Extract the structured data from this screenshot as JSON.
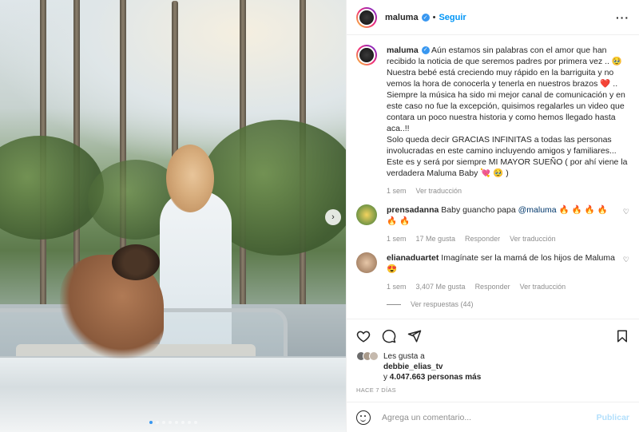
{
  "post": {
    "username": "maluma",
    "follow_label": "Seguir",
    "separator": "•",
    "more_label": "···",
    "next_label": "›"
  },
  "caption": {
    "username": "maluma",
    "text": "Aún estamos sin palabras con el amor que han recibido la noticia de que seremos padres por primera vez .. 🥹 Nuestra bebé está creciendo muy rápido en la barriguita y no vemos la hora de conocerla y tenerla en nuestros brazos ❤️ .. Siempre la música ha sido mi mejor canal de comunicación y en este caso no fue la excepción, quisimos regalarles un video que contara un poco nuestra historia y como hemos llegado hasta aca..!!",
    "text2": "Solo queda decir GRACIAS INFINITAS a todas las personas involucradas en este camino incluyendo amigos y familiares... Este es y será por siempre MI MAYOR SUEÑO ( por ahí viene la verdadera Maluma Baby 💘 🥹 )",
    "time": "1 sem",
    "translate": "Ver traducción"
  },
  "comments": [
    {
      "username": "prensadanna",
      "text": "Baby guancho papa",
      "mention": "@maluma",
      "emojis": "🔥 🔥 🔥 🔥 🔥 🔥",
      "time": "1 sem",
      "likes": "17 Me gusta",
      "reply": "Responder",
      "translate": "Ver traducción"
    },
    {
      "username": "elianaduartet",
      "text": "Imagínate ser la mamá de los hijos de Maluma",
      "emojis": "😍",
      "time": "1 sem",
      "likes": "3,407 Me gusta",
      "reply": "Responder",
      "translate": "Ver traducción",
      "replies_label": "Ver respuestas (44)"
    }
  ],
  "likes": {
    "prefix": "Les gusta a",
    "user": "debbie_elias_tv",
    "joiner": "y",
    "count": "4.047.663 personas más"
  },
  "timestamp": "HACE 7 DÍAS",
  "add_comment": {
    "placeholder": "Agrega un comentario...",
    "publish_label": "Publicar"
  },
  "carousel": {
    "slides": 8,
    "active_index": 0
  },
  "colors": {
    "accent": "#0095f6",
    "verified": "#3897f0",
    "publish_disabled": "#b2dffc"
  }
}
